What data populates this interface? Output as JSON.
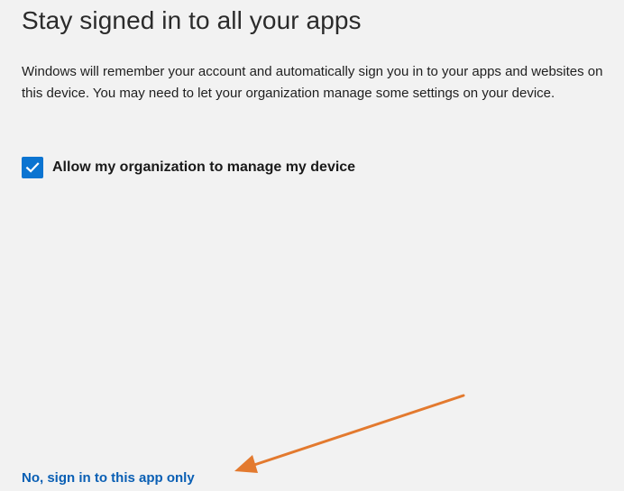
{
  "dialog": {
    "title": "Stay signed in to all your apps",
    "description": "Windows will remember your account and automatically sign you in to your apps and websites on this device. You may need to let your organization manage some settings on your device.",
    "checkbox": {
      "label": "Allow my organization to manage my device",
      "checked": true
    },
    "link_only_this_app": "No, sign in to this app only"
  },
  "colors": {
    "background": "#f2f2f2",
    "checkbox_accent": "#0b74d1",
    "link": "#0a5fb4",
    "annotation_arrow": "#e37a2f"
  },
  "icons": {
    "checkbox_checkmark": "check-icon",
    "annotation": "arrow-icon"
  }
}
